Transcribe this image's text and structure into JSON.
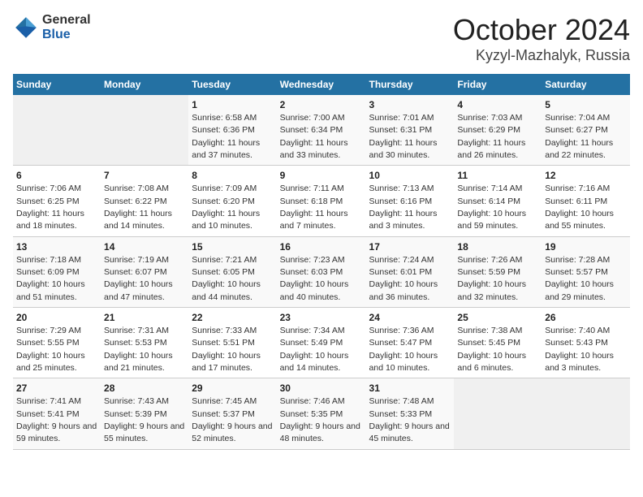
{
  "header": {
    "logo_general": "General",
    "logo_blue": "Blue",
    "month": "October 2024",
    "location": "Kyzyl-Mazhalyk, Russia"
  },
  "days_of_week": [
    "Sunday",
    "Monday",
    "Tuesday",
    "Wednesday",
    "Thursday",
    "Friday",
    "Saturday"
  ],
  "weeks": [
    [
      {
        "day": "",
        "sunrise": "",
        "sunset": "",
        "daylight": ""
      },
      {
        "day": "",
        "sunrise": "",
        "sunset": "",
        "daylight": ""
      },
      {
        "day": "1",
        "sunrise": "Sunrise: 6:58 AM",
        "sunset": "Sunset: 6:36 PM",
        "daylight": "Daylight: 11 hours and 37 minutes."
      },
      {
        "day": "2",
        "sunrise": "Sunrise: 7:00 AM",
        "sunset": "Sunset: 6:34 PM",
        "daylight": "Daylight: 11 hours and 33 minutes."
      },
      {
        "day": "3",
        "sunrise": "Sunrise: 7:01 AM",
        "sunset": "Sunset: 6:31 PM",
        "daylight": "Daylight: 11 hours and 30 minutes."
      },
      {
        "day": "4",
        "sunrise": "Sunrise: 7:03 AM",
        "sunset": "Sunset: 6:29 PM",
        "daylight": "Daylight: 11 hours and 26 minutes."
      },
      {
        "day": "5",
        "sunrise": "Sunrise: 7:04 AM",
        "sunset": "Sunset: 6:27 PM",
        "daylight": "Daylight: 11 hours and 22 minutes."
      }
    ],
    [
      {
        "day": "6",
        "sunrise": "Sunrise: 7:06 AM",
        "sunset": "Sunset: 6:25 PM",
        "daylight": "Daylight: 11 hours and 18 minutes."
      },
      {
        "day": "7",
        "sunrise": "Sunrise: 7:08 AM",
        "sunset": "Sunset: 6:22 PM",
        "daylight": "Daylight: 11 hours and 14 minutes."
      },
      {
        "day": "8",
        "sunrise": "Sunrise: 7:09 AM",
        "sunset": "Sunset: 6:20 PM",
        "daylight": "Daylight: 11 hours and 10 minutes."
      },
      {
        "day": "9",
        "sunrise": "Sunrise: 7:11 AM",
        "sunset": "Sunset: 6:18 PM",
        "daylight": "Daylight: 11 hours and 7 minutes."
      },
      {
        "day": "10",
        "sunrise": "Sunrise: 7:13 AM",
        "sunset": "Sunset: 6:16 PM",
        "daylight": "Daylight: 11 hours and 3 minutes."
      },
      {
        "day": "11",
        "sunrise": "Sunrise: 7:14 AM",
        "sunset": "Sunset: 6:14 PM",
        "daylight": "Daylight: 10 hours and 59 minutes."
      },
      {
        "day": "12",
        "sunrise": "Sunrise: 7:16 AM",
        "sunset": "Sunset: 6:11 PM",
        "daylight": "Daylight: 10 hours and 55 minutes."
      }
    ],
    [
      {
        "day": "13",
        "sunrise": "Sunrise: 7:18 AM",
        "sunset": "Sunset: 6:09 PM",
        "daylight": "Daylight: 10 hours and 51 minutes."
      },
      {
        "day": "14",
        "sunrise": "Sunrise: 7:19 AM",
        "sunset": "Sunset: 6:07 PM",
        "daylight": "Daylight: 10 hours and 47 minutes."
      },
      {
        "day": "15",
        "sunrise": "Sunrise: 7:21 AM",
        "sunset": "Sunset: 6:05 PM",
        "daylight": "Daylight: 10 hours and 44 minutes."
      },
      {
        "day": "16",
        "sunrise": "Sunrise: 7:23 AM",
        "sunset": "Sunset: 6:03 PM",
        "daylight": "Daylight: 10 hours and 40 minutes."
      },
      {
        "day": "17",
        "sunrise": "Sunrise: 7:24 AM",
        "sunset": "Sunset: 6:01 PM",
        "daylight": "Daylight: 10 hours and 36 minutes."
      },
      {
        "day": "18",
        "sunrise": "Sunrise: 7:26 AM",
        "sunset": "Sunset: 5:59 PM",
        "daylight": "Daylight: 10 hours and 32 minutes."
      },
      {
        "day": "19",
        "sunrise": "Sunrise: 7:28 AM",
        "sunset": "Sunset: 5:57 PM",
        "daylight": "Daylight: 10 hours and 29 minutes."
      }
    ],
    [
      {
        "day": "20",
        "sunrise": "Sunrise: 7:29 AM",
        "sunset": "Sunset: 5:55 PM",
        "daylight": "Daylight: 10 hours and 25 minutes."
      },
      {
        "day": "21",
        "sunrise": "Sunrise: 7:31 AM",
        "sunset": "Sunset: 5:53 PM",
        "daylight": "Daylight: 10 hours and 21 minutes."
      },
      {
        "day": "22",
        "sunrise": "Sunrise: 7:33 AM",
        "sunset": "Sunset: 5:51 PM",
        "daylight": "Daylight: 10 hours and 17 minutes."
      },
      {
        "day": "23",
        "sunrise": "Sunrise: 7:34 AM",
        "sunset": "Sunset: 5:49 PM",
        "daylight": "Daylight: 10 hours and 14 minutes."
      },
      {
        "day": "24",
        "sunrise": "Sunrise: 7:36 AM",
        "sunset": "Sunset: 5:47 PM",
        "daylight": "Daylight: 10 hours and 10 minutes."
      },
      {
        "day": "25",
        "sunrise": "Sunrise: 7:38 AM",
        "sunset": "Sunset: 5:45 PM",
        "daylight": "Daylight: 10 hours and 6 minutes."
      },
      {
        "day": "26",
        "sunrise": "Sunrise: 7:40 AM",
        "sunset": "Sunset: 5:43 PM",
        "daylight": "Daylight: 10 hours and 3 minutes."
      }
    ],
    [
      {
        "day": "27",
        "sunrise": "Sunrise: 7:41 AM",
        "sunset": "Sunset: 5:41 PM",
        "daylight": "Daylight: 9 hours and 59 minutes."
      },
      {
        "day": "28",
        "sunrise": "Sunrise: 7:43 AM",
        "sunset": "Sunset: 5:39 PM",
        "daylight": "Daylight: 9 hours and 55 minutes."
      },
      {
        "day": "29",
        "sunrise": "Sunrise: 7:45 AM",
        "sunset": "Sunset: 5:37 PM",
        "daylight": "Daylight: 9 hours and 52 minutes."
      },
      {
        "day": "30",
        "sunrise": "Sunrise: 7:46 AM",
        "sunset": "Sunset: 5:35 PM",
        "daylight": "Daylight: 9 hours and 48 minutes."
      },
      {
        "day": "31",
        "sunrise": "Sunrise: 7:48 AM",
        "sunset": "Sunset: 5:33 PM",
        "daylight": "Daylight: 9 hours and 45 minutes."
      },
      {
        "day": "",
        "sunrise": "",
        "sunset": "",
        "daylight": ""
      },
      {
        "day": "",
        "sunrise": "",
        "sunset": "",
        "daylight": ""
      }
    ]
  ]
}
